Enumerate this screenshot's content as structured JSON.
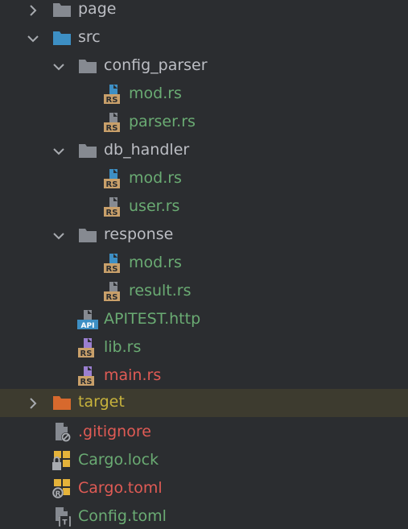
{
  "colors": {
    "background": "#2b2d30",
    "text_default": "#bcbec4",
    "text_modified": "#6aab73",
    "text_error": "#e05b55",
    "text_excluded": "#c8b33c",
    "folder_gray": "#868a91",
    "folder_blue": "#3d8fc4",
    "folder_orange": "#d7692d",
    "rust_badge": "#c9a06a",
    "selected_row": "#3d3b2f"
  },
  "tree": [
    {
      "label": "page",
      "type": "folder",
      "expanded": false,
      "icon": "folder-icon",
      "color": "default"
    },
    {
      "label": "src",
      "type": "folder",
      "expanded": true,
      "icon": "source-folder-icon",
      "color": "default"
    },
    {
      "label": "config_parser",
      "type": "folder",
      "expanded": true,
      "icon": "folder-icon",
      "color": "default"
    },
    {
      "label": "mod.rs",
      "type": "file",
      "icon": "rust-mod-file-icon",
      "color": "green"
    },
    {
      "label": "parser.rs",
      "type": "file",
      "icon": "rust-file-icon",
      "color": "green"
    },
    {
      "label": "db_handler",
      "type": "folder",
      "expanded": true,
      "icon": "folder-icon",
      "color": "default"
    },
    {
      "label": "mod.rs",
      "type": "file",
      "icon": "rust-mod-file-icon",
      "color": "green"
    },
    {
      "label": "user.rs",
      "type": "file",
      "icon": "rust-file-icon",
      "color": "green"
    },
    {
      "label": "response",
      "type": "folder",
      "expanded": true,
      "icon": "folder-icon",
      "color": "default"
    },
    {
      "label": "mod.rs",
      "type": "file",
      "icon": "rust-mod-file-icon",
      "color": "green"
    },
    {
      "label": "result.rs",
      "type": "file",
      "icon": "rust-file-icon",
      "color": "green"
    },
    {
      "label": "APITEST.http",
      "type": "file",
      "icon": "http-api-file-icon",
      "color": "green"
    },
    {
      "label": "lib.rs",
      "type": "file",
      "icon": "rust-lib-file-icon",
      "color": "green"
    },
    {
      "label": "main.rs",
      "type": "file",
      "icon": "rust-main-file-icon",
      "color": "red"
    },
    {
      "label": "target",
      "type": "folder",
      "expanded": false,
      "icon": "excluded-folder-icon",
      "color": "yellow",
      "selected": true
    },
    {
      "label": ".gitignore",
      "type": "file",
      "icon": "gitignore-file-icon",
      "color": "red"
    },
    {
      "label": "Cargo.lock",
      "type": "file",
      "icon": "cargo-lock-file-icon",
      "color": "green"
    },
    {
      "label": "Cargo.toml",
      "type": "file",
      "icon": "cargo-toml-file-icon",
      "color": "red"
    },
    {
      "label": "Config.toml",
      "type": "file",
      "icon": "toml-file-icon",
      "color": "green"
    }
  ]
}
